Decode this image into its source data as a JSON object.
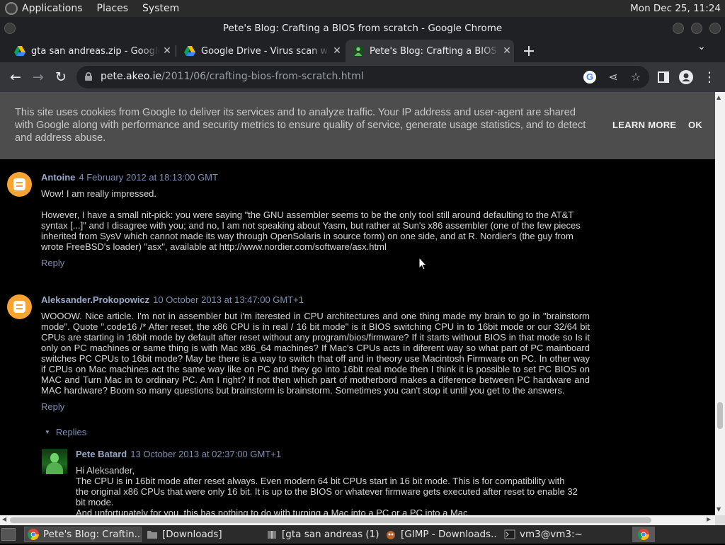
{
  "topbar": {
    "menus": [
      "Applications",
      "Places",
      "System"
    ],
    "clock": "Mon Dec 25, 11:24"
  },
  "window": {
    "title": "Pete's Blog: Crafting a BIOS from scratch - Google Chrome"
  },
  "tabs": [
    {
      "label": "gta san andreas.zip - Google Drive",
      "icon": "google-drive-icon",
      "active": false
    },
    {
      "label": "Google Drive - Virus scan warning",
      "icon": "google-drive-icon",
      "active": false
    },
    {
      "label": "Pete's Blog: Crafting a BIOS from scratch",
      "icon": "blog-favicon",
      "active": true
    }
  ],
  "toolbar": {
    "url_host": "pete.akeo.ie",
    "url_path": "/2011/06/crafting-bios-from-scratch.html",
    "google_badge": "G"
  },
  "cookie_banner": {
    "message": "This site uses cookies from Google to deliver its services and to analyze traffic. Your IP address and user-agent are shared with Google along with performance and security metrics to ensure quality of service, generate usage statistics, and to detect and address abuse.",
    "learn_more": "LEARN MORE",
    "ok": "OK"
  },
  "comments": [
    {
      "author": "Antoine",
      "date": "4 February 2012 at 18:13:00 GMT",
      "paragraphs": [
        "Wow! I am really impressed.",
        "However, I have a small nit-pick: you were saying \"the GNU assembler seems to be the only tool still around defaulting to the AT&T syntax [...]\" and I disagree with you; and no, I am not speaking about Yasm, but rather at Sun's x86 assembler (one of the few pieces inherited from SysV which cannot made its way through OpenSolaris in source form) on one side, and at R. Nordier's (the guy from wrote FreeBSD's loader) \"asx\", available at http://www.nordier.com/software/asx.html"
      ],
      "reply": "Reply"
    },
    {
      "author": "Aleksander.Prokopowicz",
      "date": "10 October 2013 at 13:47:00 GMT+1",
      "paragraphs": [
        "WOOOW. Nice article. I'm not in assembler but i'm iterested in CPU architectures and one thing made my brain to go in \"brainstorm mode\". Quote \".code16 /* After reset, the x86 CPU is in real / 16 bit mode\" is it BIOS switching CPU in to 16bit mode or our 32/64 bit CPUs are starting in 16bit mode by default after reset without any program/bios/firmware? If it starts without BIOS in that mode so Is it only on PC machines or same thing is with Mac x86_64 machines? If Mac's CPUs acts in diferent way so what part of PC mainboard switches PC CPUs to 16bit mode? May be there is a way to switch that off and in theory use Macintosh Firmware on PC. In other way if CPUs on Mac machines act the same way like on PC and they go into 16bit real mode then I think it is possible to set PC BIOS on MAC and Turn Mac in to ordinary PC. Am I right? If not then which part of motherbord makes a diference between PC hardware and MAC hardware? Boom so many questions but brainstorm is brainstorm. Sometimes you can't stop it until you get to the answers."
      ],
      "reply": "Reply",
      "replies_label": "Replies"
    }
  ],
  "nested_reply": {
    "author": "Pete Batard",
    "date": "13 October 2013 at 02:37:00 GMT+1",
    "greeting": "Hi Aleksander,",
    "paragraph1": "The CPU is in 16bit mode after reset always. Even modern 64 bit CPUs start in 16 bit mode. This is for compatibility with the original x86 CPUs that were only 16 bit. It is up to the BIOS or whatever firmware gets executed after reset to enable 32 bit mode.",
    "paragraph2": "And unfortunately for you, this has nothing to do with turning a Mac into a PC or a PC into a Mac."
  },
  "taskbar": {
    "tasks": [
      {
        "label": "Pete's Blog: Craftin...",
        "icon": "chrome-icon",
        "active": true
      },
      {
        "label": "[Downloads]",
        "icon": "folder-icon",
        "active": false
      },
      {
        "label": "[gta san andreas (1)....",
        "icon": "archive-icon",
        "active": false
      },
      {
        "label": "[GIMP - Downloads...",
        "icon": "gimp-icon",
        "active": false
      },
      {
        "label": "vm3@vm3:~",
        "icon": "terminal-icon",
        "active": false
      }
    ]
  },
  "colors": {
    "link": "#7f8fb3",
    "author": "#98a9c9",
    "blogger_orange": "#f7a433",
    "cookie_bg": "#4d4d4d"
  }
}
